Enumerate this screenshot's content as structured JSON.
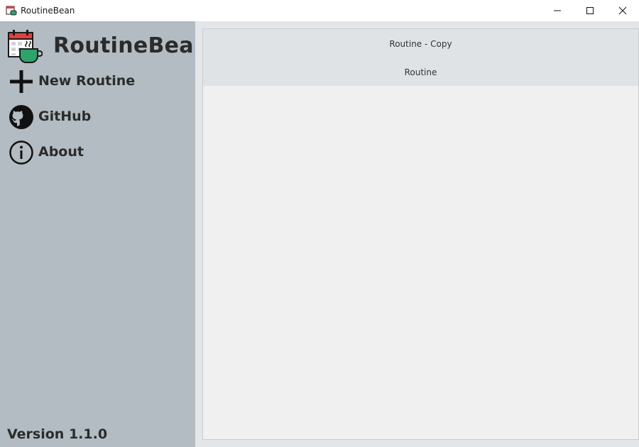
{
  "window": {
    "title": "RoutineBean",
    "minimize_icon": "minimize-icon",
    "maximize_icon": "maximize-icon",
    "close_icon": "close-icon"
  },
  "sidebar": {
    "brand": {
      "name": "RoutineBean",
      "logo": "calendar-coffee-icon"
    },
    "items": [
      {
        "label": "New Routine",
        "icon": "plus-icon"
      },
      {
        "label": "GitHub",
        "icon": "github-icon"
      },
      {
        "label": "About",
        "icon": "info-icon"
      }
    ],
    "version": "Version 1.1.0"
  },
  "routines": [
    {
      "label": "Routine - Copy"
    },
    {
      "label": "Routine"
    }
  ],
  "colors": {
    "sidebar_bg": "#b2bcc2",
    "main_bg": "#e3e6e8",
    "panel_bg": "#f0f0f0",
    "routine_item_bg": "#dfe3e6",
    "text_dark": "#2b2b2b",
    "logo_red": "#e04040",
    "logo_green": "#2fa36b"
  }
}
